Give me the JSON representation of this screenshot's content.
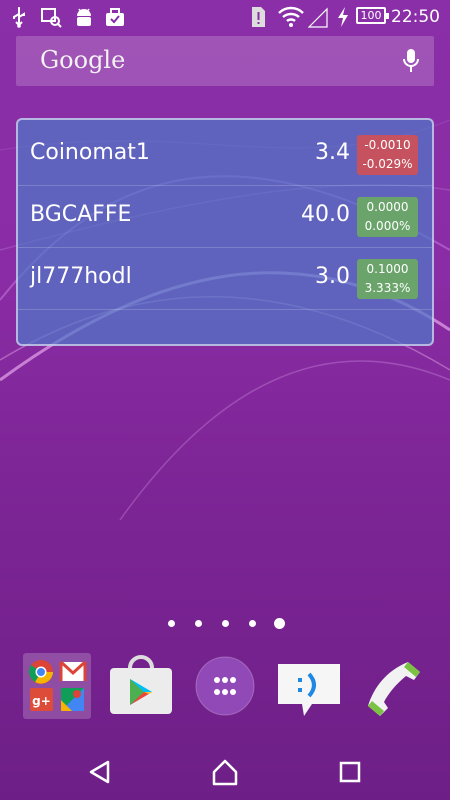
{
  "status_bar": {
    "time": "22:50",
    "battery_level": "100",
    "left_icons": [
      "usb-icon",
      "screenshot-icon",
      "android-debug-icon",
      "briefcase-icon"
    ],
    "right_icons": [
      "sim-alert-icon",
      "wifi-icon",
      "cell-signal-icon",
      "charging-bolt-icon",
      "battery-icon"
    ]
  },
  "search_bar": {
    "logo": "Google",
    "icon": "mic-icon"
  },
  "ticker_widget": {
    "rows": [
      {
        "name": "Coinomat1",
        "price": "3.4",
        "change": "-0.0010",
        "change_pct": "-0.029%",
        "badge_color": "#c5525e"
      },
      {
        "name": "BGCAFFE",
        "price": "40.0",
        "change": "0.0000",
        "change_pct": "0.000%",
        "badge_color": "#6aa46a"
      },
      {
        "name": "jl777hodl",
        "price": "3.0",
        "change": "0.1000",
        "change_pct": "3.333%",
        "badge_color": "#6aa46a"
      }
    ]
  },
  "home": {
    "page_count": 5,
    "active_page": 5
  },
  "dock": {
    "items": [
      "google-apps-folder",
      "play-store-icon",
      "app-drawer-icon",
      "messaging-icon",
      "phone-icon"
    ]
  },
  "nav_bar": {
    "buttons": [
      "back-icon",
      "home-icon",
      "recents-icon"
    ]
  },
  "colors": {
    "wallpaper": "#8a2ca5",
    "widget": "#5078c8",
    "negative": "#c5525e",
    "positive": "#6aa46a"
  }
}
